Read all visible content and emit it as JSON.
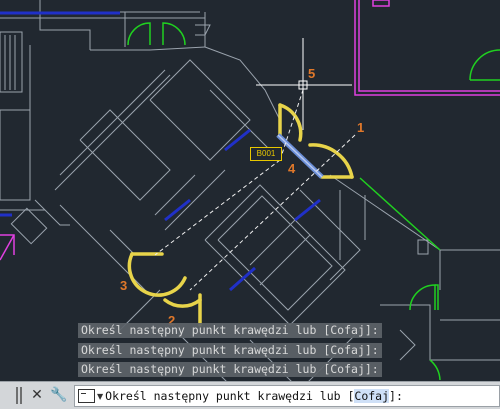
{
  "drawing": {
    "room_tag": "B001",
    "callouts": [
      "5",
      "1",
      "4",
      "3",
      "2"
    ]
  },
  "command_history": [
    "Określ następny punkt krawędzi lub [Cofaj]:",
    "Określ następny punkt krawędzi lub [Cofaj]:",
    "Określ następny punkt krawędzi lub [Cofaj]:"
  ],
  "command_line": {
    "prompt": "Określ następny punkt krawędzi lub [",
    "option": "Cofaj",
    "suffix": "]:",
    "close_icon": "close-icon",
    "settings_icon": "wrench-icon"
  },
  "colors": {
    "background": "#212830",
    "walls": "#9aa3ad",
    "magenta_layer": "#e040e0",
    "green_doors": "#20d020",
    "blue_windows": "#2030c8",
    "selected_highlight": "#e8d44a",
    "callout": "#e0782a"
  }
}
